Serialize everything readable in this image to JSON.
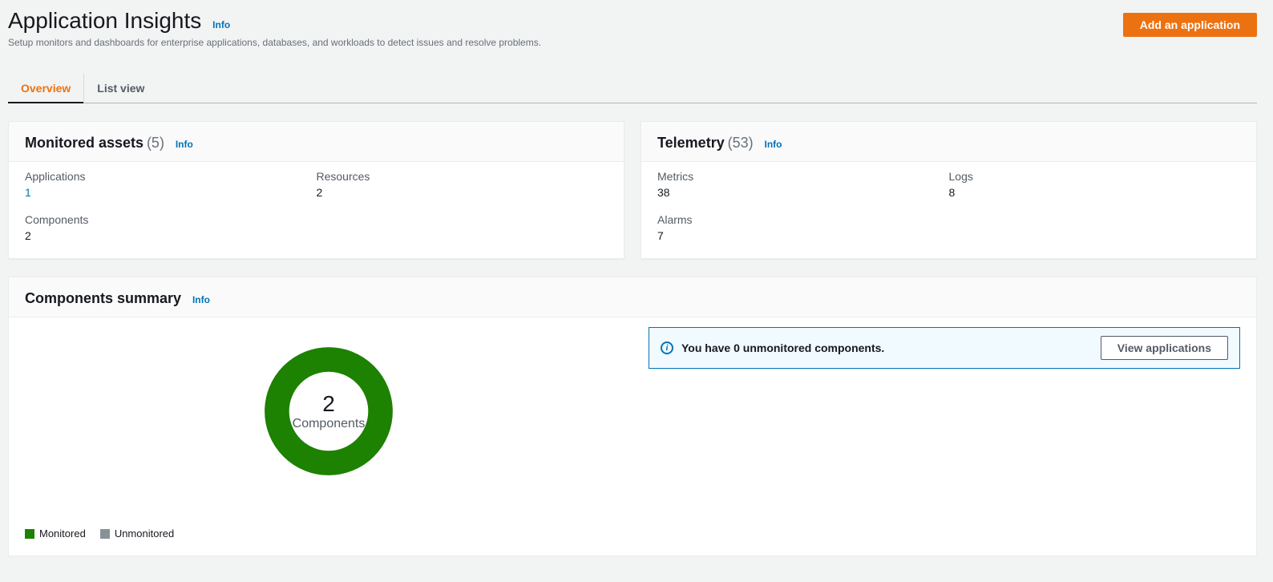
{
  "header": {
    "title": "Application Insights",
    "info": "Info",
    "subtitle": "Setup monitors and dashboards for enterprise applications, databases, and workloads to detect issues and resolve problems.",
    "add_button": "Add an application"
  },
  "tabs": {
    "overview": "Overview",
    "list_view": "List view"
  },
  "monitored_assets": {
    "title": "Monitored assets",
    "count": "(5)",
    "info": "Info",
    "applications_label": "Applications",
    "applications_value": "1",
    "resources_label": "Resources",
    "resources_value": "2",
    "components_label": "Components",
    "components_value": "2"
  },
  "telemetry": {
    "title": "Telemetry",
    "count": "(53)",
    "info": "Info",
    "metrics_label": "Metrics",
    "metrics_value": "38",
    "logs_label": "Logs",
    "logs_value": "8",
    "alarms_label": "Alarms",
    "alarms_value": "7"
  },
  "components_summary": {
    "title": "Components summary",
    "info": "Info",
    "donut_value": "2",
    "donut_label": "Components",
    "legend_monitored": "Monitored",
    "legend_unmonitored": "Unmonitored",
    "banner_text": "You have 0 unmonitored components.",
    "view_applications": "View applications"
  },
  "chart_data": {
    "type": "pie",
    "title": "Components summary",
    "series": [
      {
        "name": "Monitored",
        "value": 2,
        "color": "#1d8102"
      },
      {
        "name": "Unmonitored",
        "value": 0,
        "color": "#879196"
      }
    ],
    "total": 2,
    "center_label": "Components"
  }
}
